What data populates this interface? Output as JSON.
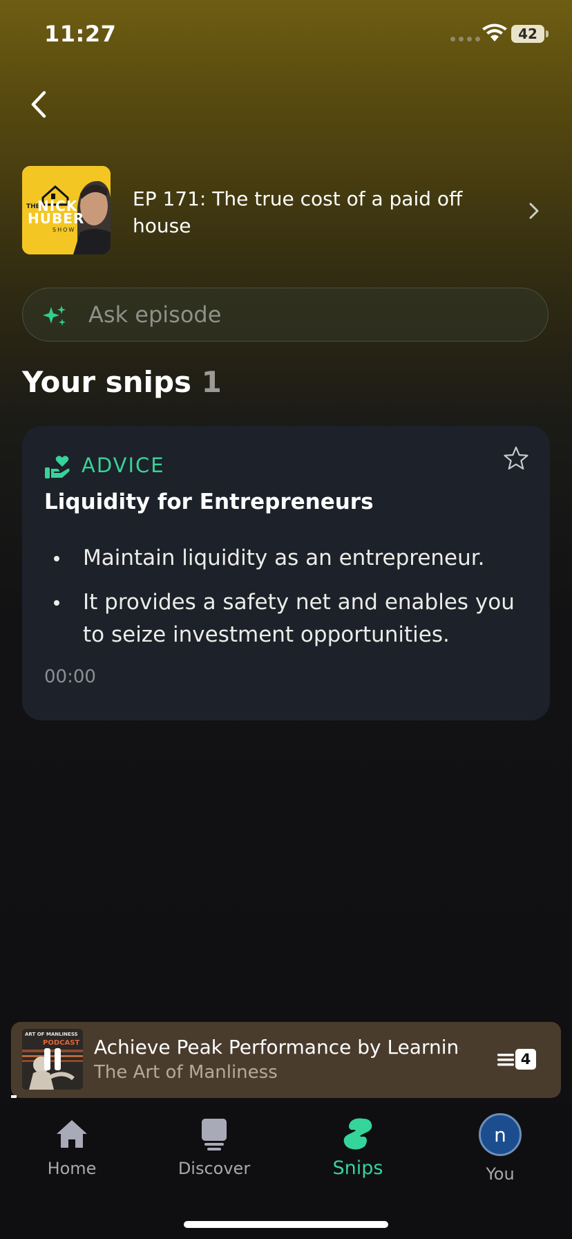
{
  "status_bar": {
    "time": "11:27",
    "battery": "42"
  },
  "episode": {
    "title": "EP 171: The true cost of a paid off house",
    "artwork_text": {
      "small": "THE",
      "line1": "NICK",
      "line2": "HUBER",
      "line3": "SHOW"
    }
  },
  "search": {
    "placeholder": "Ask episode"
  },
  "snips_section": {
    "title": "Your snips",
    "count": "1"
  },
  "snip_card": {
    "category": "ADVICE",
    "title": "Liquidity for Entrepreneurs",
    "bullets": [
      "Maintain liquidity as an entrepreneur.",
      "It provides a safety net and enables you to seize investment opportunities."
    ],
    "timestamp": "00:00"
  },
  "mini_player": {
    "title": "Achieve Peak Performance by Learning",
    "podcast": "The Art of Manliness",
    "queue_count": "4",
    "progress": 0.01,
    "artwork_text": {
      "top": "ART OF MANLINESS",
      "bottom": "PODCAST"
    }
  },
  "tabs": [
    {
      "label": "Home",
      "icon": "home-icon",
      "active": false
    },
    {
      "label": "Discover",
      "icon": "discover-icon",
      "active": false
    },
    {
      "label": "Snips",
      "icon": "snips-icon",
      "active": true
    },
    {
      "label": "You",
      "icon": "avatar",
      "active": false,
      "avatar_letter": "n"
    }
  ],
  "colors": {
    "accent": "#35d49a",
    "card_bg": "#1d2129",
    "player_bg": "#4a3c2d",
    "avatar_bg": "#1b4d8f"
  }
}
